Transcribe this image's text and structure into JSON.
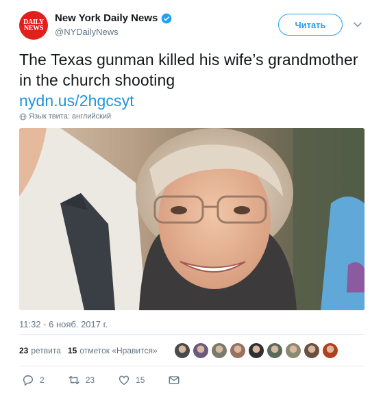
{
  "header": {
    "avatar_lines": [
      "DAILY",
      "NEWS"
    ],
    "display_name": "New York Daily News",
    "handle": "@NYDailyNews",
    "follow_label": "Читать",
    "verified": true
  },
  "tweet": {
    "text": "The Texas gunman killed his wife’s grandmother in the church shooting",
    "link": "nydn.us/2hgcsyt",
    "language_note": "Язык твита: английский",
    "image_description_icon": "photo-of-woman-icon"
  },
  "meta": {
    "timestamp": "11:32 - 6 нояб. 2017 г.",
    "retweets_count": "23",
    "retweets_label": "ретвита",
    "likes_count": "15",
    "likes_label": "отметок «Нравится»",
    "liker_colors": [
      "#4a4a4a",
      "#6b5a7a",
      "#7a7a6a",
      "#9a7060",
      "#303030",
      "#5a6a5a",
      "#8a8a70",
      "#6a5040",
      "#b04020"
    ]
  },
  "actions": {
    "reply_count": "2",
    "retweet_count": "23",
    "like_count": "15"
  },
  "colors": {
    "accent": "#1da1f2",
    "link": "#1b95e0",
    "secondary_text": "#657786",
    "brand_red": "#e0201a"
  }
}
